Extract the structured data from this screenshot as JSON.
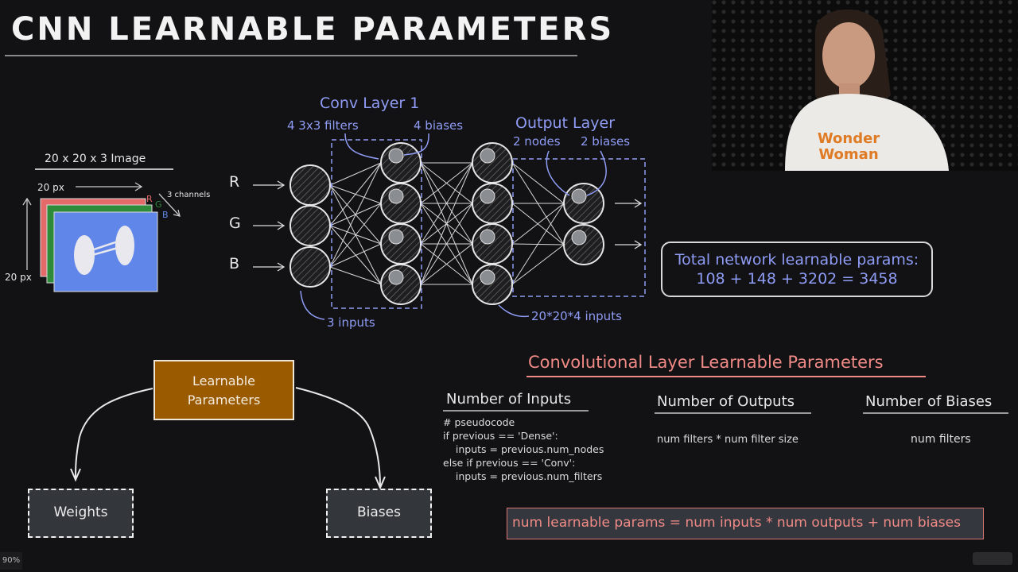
{
  "title": "CNN LEARNABLE PARAMETERS",
  "image_panel": {
    "heading": "20 x 20 x 3 Image",
    "width_label": "20 px",
    "height_label": "20 px",
    "channels_label": "3 channels",
    "channel_letters": [
      "R",
      "G",
      "B"
    ],
    "channel_colors": [
      "#e46a6a",
      "#2e8b3a",
      "#5f86e8"
    ]
  },
  "network": {
    "input_labels": [
      "R",
      "G",
      "B"
    ],
    "conv_layer_title": "Conv Layer 1",
    "conv_filters_label": "4 3x3 filters",
    "conv_biases_label": "4 biases",
    "output_layer_title": "Output Layer",
    "output_nodes_label": "2 nodes",
    "output_biases_label": "2 biases",
    "inputs_note": "3 inputs",
    "flatten_note": "20*20*4 inputs",
    "layer_sizes": [
      3,
      4,
      4,
      2
    ]
  },
  "total": {
    "line1": "Total network learnable params:",
    "line2": "108 + 148 + 3202 = 3458"
  },
  "conv_section": {
    "title": "Convolutional Layer Learnable Parameters",
    "columns": [
      {
        "heading": "Number of Inputs"
      },
      {
        "heading": "Number of Outputs",
        "body": "num filters * num filter size"
      },
      {
        "heading": "Number of Biases",
        "body": "num filters"
      }
    ],
    "pseudocode": "# pseudocode\nif previous == 'Dense':\n    inputs = previous.num_nodes\nelse if previous == 'Conv':\n    inputs = previous.num_filters",
    "formula": "num learnable params = num inputs * num outputs + num biases"
  },
  "tree": {
    "root": "Learnable Parameters",
    "left": "Weights",
    "right": "Biases"
  },
  "player": {
    "zoom_level": "90%"
  },
  "colors": {
    "accent_blue": "#8f9cf5",
    "accent_pink": "#f08a86",
    "root_box": "#9a5a00"
  }
}
